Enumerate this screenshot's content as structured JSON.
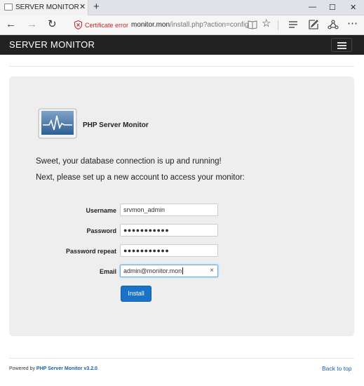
{
  "browser": {
    "tab_title": "SERVER MONITOR",
    "tab_close": "✕",
    "new_tab": "+",
    "window": {
      "minimize": "—",
      "maximize": "☐",
      "close": "✕"
    },
    "back": "←",
    "forward": "→",
    "refresh": "↻",
    "cert_error": "Certificate error",
    "url_host": "monitor.mon",
    "url_path": "/install.php?action=config",
    "favorite": "☆",
    "more": "⋯"
  },
  "app": {
    "brand": "SERVER MONITOR"
  },
  "install": {
    "logo_title": "PHP Server Monitor",
    "message_1": "Sweet, your database connection is up and running!",
    "message_2": "Next, please set up a new account to access your monitor:",
    "fields": [
      {
        "label": "Username",
        "value": "srvmon_admin"
      },
      {
        "label": "Password",
        "value": "●●●●●●●●●●●"
      },
      {
        "label": "Password repeat",
        "value": "●●●●●●●●●●●"
      },
      {
        "label": "Email",
        "value": "admin@monitor.mon"
      }
    ],
    "clear_icon": "×",
    "install_label": "Install"
  },
  "footer": {
    "powered_prefix": "Powered by",
    "powered_link": "PHP Server Monitor v3.2.0",
    "powered_suffix": ".",
    "back_to_top": "Back to top"
  },
  "colors": {
    "appbar": "#222222",
    "panel": "#eeeeee",
    "primary": "#1a73c8",
    "link": "#1a5fa8",
    "cert_error": "#c62828"
  }
}
